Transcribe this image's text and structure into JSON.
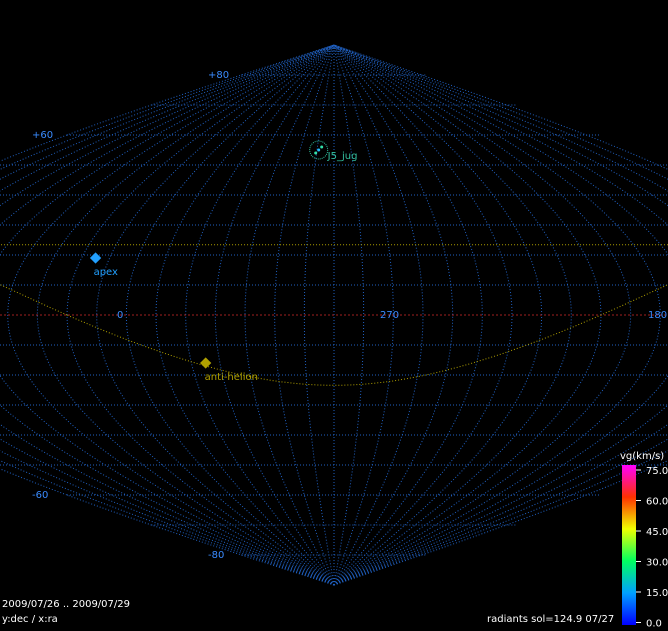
{
  "chart_data": {
    "type": "scatter",
    "projection": "sinusoidal",
    "x_axis": "ra",
    "y_axis": "dec",
    "dec_labels": [
      "+80",
      "+60",
      "-60",
      "-80"
    ],
    "ra_labels": [
      "0",
      "270",
      "180"
    ],
    "points": [
      {
        "label": "apex",
        "ra": 355,
        "dec": 19,
        "color": "#22a0ff"
      },
      {
        "label": "anti-helion",
        "ra": 315,
        "dec": -16,
        "color": "#b0a000"
      },
      {
        "label": "J5_jug",
        "ra": 279,
        "dec": 55,
        "color": "#33e0aa"
      }
    ],
    "colorbar": {
      "title": "vg(km/s)",
      "ticks": [
        "75.0",
        "60.0",
        "45.0",
        "30.0",
        "15.0",
        "0.0"
      ]
    }
  },
  "footer": {
    "date_range": "2009/07/26 .. 2009/07/29",
    "axes": "y:dec / x:ra",
    "status": "radiants sol=124.9 07/27"
  }
}
